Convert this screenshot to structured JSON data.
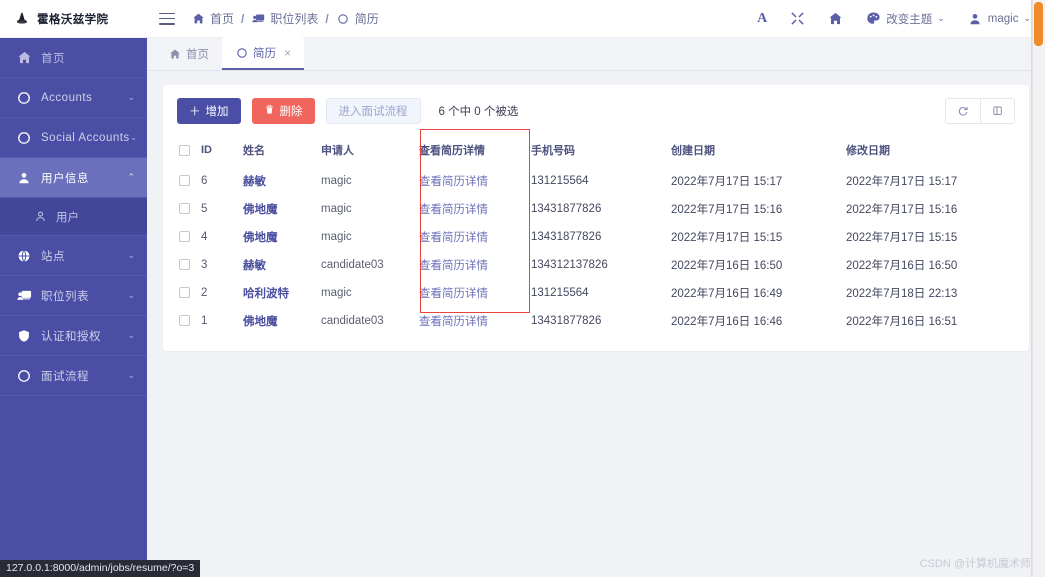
{
  "brand": {
    "title": "霍格沃兹学院",
    "logo_icon": "wizard-hat-icon"
  },
  "sidebar": {
    "items": [
      {
        "label": "首页",
        "icon": "home-icon",
        "chevron": "",
        "active": false,
        "state": "home"
      },
      {
        "label": "Accounts",
        "icon": "circle-icon",
        "chevron": "⌄",
        "active": false
      },
      {
        "label": "Social Accounts",
        "icon": "circle-icon",
        "chevron": "⌄",
        "active": false
      },
      {
        "label": "用户信息",
        "icon": "user-icon",
        "chevron": "⌃",
        "active": true
      },
      {
        "label": "站点",
        "icon": "globe-icon",
        "chevron": "⌄",
        "active": false
      },
      {
        "label": "职位列表",
        "icon": "job-list-icon",
        "chevron": "⌄",
        "active": false
      },
      {
        "label": "认证和授权",
        "icon": "shield-icon",
        "chevron": "⌄",
        "active": false
      },
      {
        "label": "面试流程",
        "icon": "circle-icon",
        "chevron": "⌄",
        "active": false
      }
    ],
    "sub_item": {
      "label": "用户",
      "icon": "user-outline-icon"
    }
  },
  "topbar": {
    "menu_icon": "hamburger-icon",
    "breadcrumb": [
      {
        "label": "首页",
        "icon": "home-icon"
      },
      {
        "label": "职位列表",
        "icon": "job-list-icon"
      },
      {
        "label": "简历",
        "icon": "circle-icon"
      }
    ],
    "separator": "/",
    "font_size_label": "A",
    "fullscreen_icon": "expand-icon",
    "home_icon": "home-icon",
    "theme": {
      "label": "改变主题",
      "icon": "palette-icon",
      "chevron": "⌄"
    },
    "user": {
      "label": "magic",
      "icon": "user-icon",
      "chevron": "⌄"
    }
  },
  "tabs": [
    {
      "label": "首页",
      "icon": "home-icon",
      "active": false,
      "closable": false
    },
    {
      "label": "简历",
      "icon": "circle-icon",
      "active": true,
      "closable": true,
      "close_glyph": "×"
    }
  ],
  "toolbar": {
    "add_label": "增加",
    "add_icon": "plus-icon",
    "delete_label": "删除",
    "delete_icon": "trash-icon",
    "flow_label": "进入面试流程",
    "selection_text": "6 个中 0 个被选",
    "refresh_icon": "refresh-icon",
    "columns_icon": "columns-icon"
  },
  "table": {
    "columns": [
      "ID",
      "姓名",
      "申请人",
      "查看简历详情",
      "手机号码",
      "创建日期",
      "修改日期"
    ],
    "rows": [
      {
        "id": "6",
        "name": "赫敏",
        "applicant": "magic",
        "detail": "查看简历详情",
        "phone": "131215564",
        "created": "2022年7月17日 15:17",
        "modified": "2022年7月17日 15:17"
      },
      {
        "id": "5",
        "name": "佛地魔",
        "applicant": "magic",
        "detail": "查看简历详情",
        "phone": "13431877826",
        "created": "2022年7月17日 15:16",
        "modified": "2022年7月17日 15:16"
      },
      {
        "id": "4",
        "name": "佛地魔",
        "applicant": "magic",
        "detail": "查看简历详情",
        "phone": "13431877826",
        "created": "2022年7月17日 15:15",
        "modified": "2022年7月17日 15:15"
      },
      {
        "id": "3",
        "name": "赫敏",
        "applicant": "candidate03",
        "detail": "查看简历详情",
        "phone": "134312137826",
        "created": "2022年7月16日 16:50",
        "modified": "2022年7月16日 16:50"
      },
      {
        "id": "2",
        "name": "哈利波特",
        "applicant": "magic",
        "detail": "查看简历详情",
        "phone": "131215564",
        "created": "2022年7月16日 16:49",
        "modified": "2022年7月18日 22:13"
      },
      {
        "id": "1",
        "name": "佛地魔",
        "applicant": "candidate03",
        "detail": "查看简历详情",
        "phone": "13431877826",
        "created": "2022年7月16日 16:46",
        "modified": "2022年7月16日 16:51"
      }
    ]
  },
  "annotation": {
    "highlight_column": "查看简历详情",
    "color": "#e8423c"
  },
  "status_bar": {
    "url": "127.0.0.1:8000/admin/jobs/resume/?o=3"
  },
  "watermark": {
    "text": "CSDN @计算机魔术师"
  },
  "colors": {
    "sidebar": "#4a4fa5",
    "sidebar_active": "#6b70bd",
    "primary": "#4a4fa5",
    "danger": "#f0665e",
    "link": "#6b70b8",
    "scrollbar_thumb": "#f08a2a"
  }
}
